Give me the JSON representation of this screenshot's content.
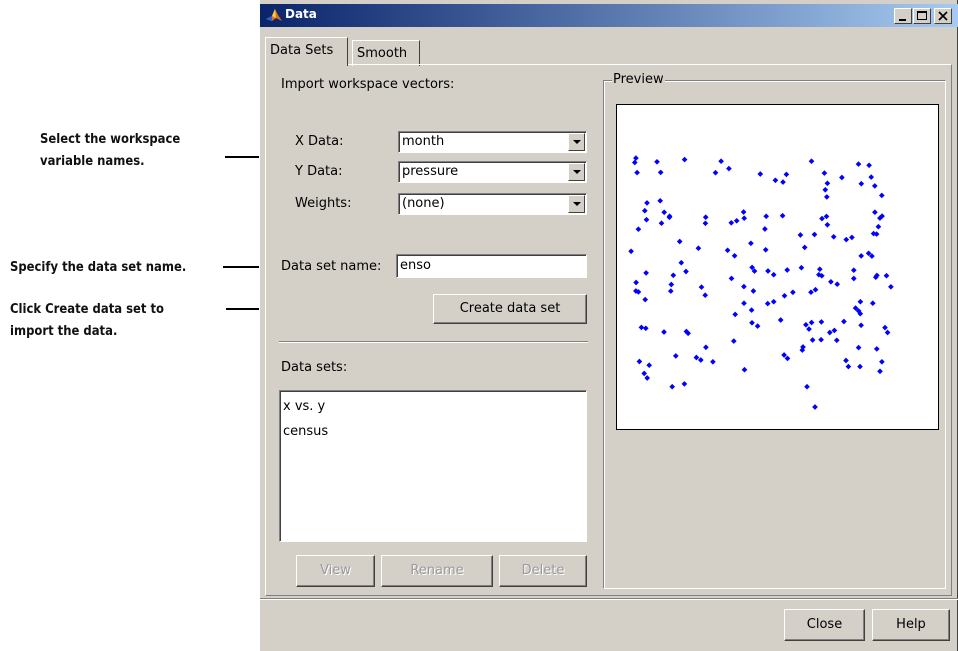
{
  "annotations": {
    "select_line1": "Select the workspace",
    "select_line2": "variable names.",
    "specify": "Specify the data set name.",
    "click_prefix": "Click ",
    "click_bold": "Create data set",
    "click_suffix": " to",
    "click_line2": "import the data."
  },
  "window": {
    "title": "Data",
    "icon": "matlab-logo-icon",
    "title_bar_color": "#0a246a"
  },
  "tabs": [
    {
      "label": "Data Sets",
      "active": true
    },
    {
      "label": "Smooth",
      "active": false
    }
  ],
  "import": {
    "heading": "Import workspace vectors:",
    "x_label": "X Data:",
    "x_value": "month",
    "y_label": "Y Data:",
    "y_value": "pressure",
    "weights_label": "Weights:",
    "weights_value": "(none)",
    "name_label": "Data set name:",
    "name_value": "enso",
    "create_button": "Create data set"
  },
  "datasets": {
    "heading": "Data sets:",
    "items": [
      "x vs. y",
      "census"
    ],
    "view_button": "View",
    "rename_button": "Rename",
    "delete_button": "Delete"
  },
  "preview": {
    "title": "Preview",
    "marker_color": "#0000ff"
  },
  "footer": {
    "close_button": "Close",
    "help_button": "Help"
  }
}
